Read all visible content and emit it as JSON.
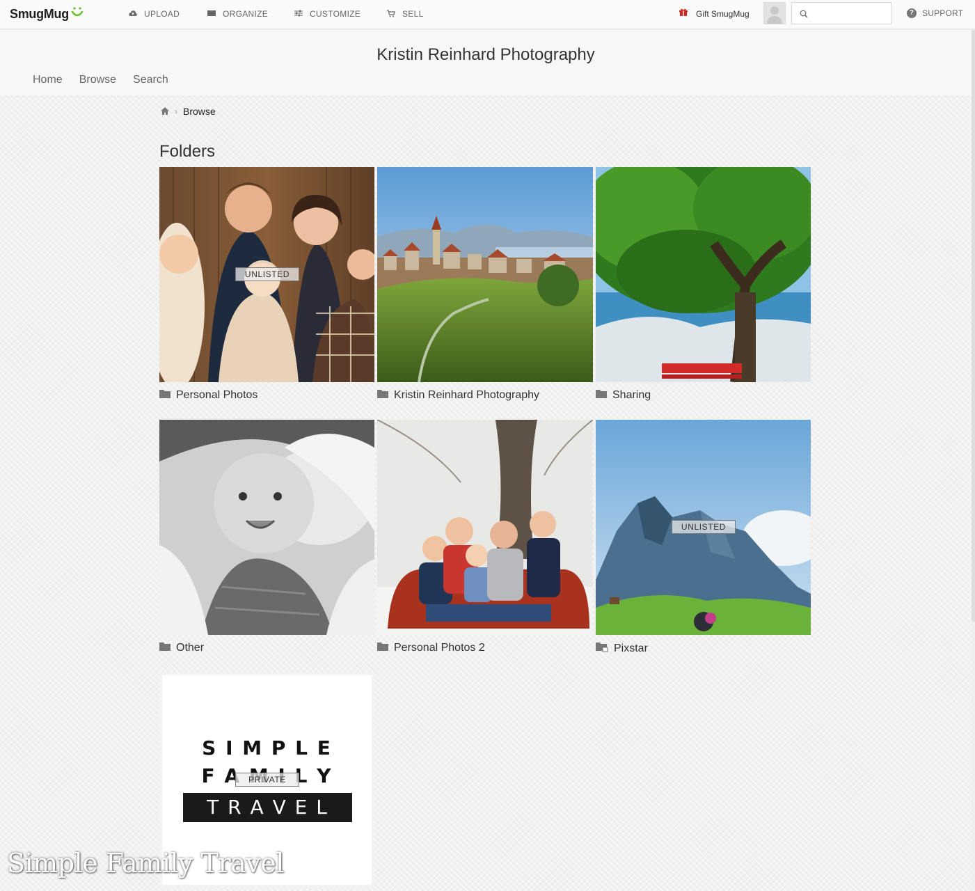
{
  "toolbar": {
    "logo": "SmugMug",
    "nav": [
      "UPLOAD",
      "ORGANIZE",
      "CUSTOMIZE",
      "SELL"
    ],
    "gift_label": "Gift SmugMug",
    "search_placeholder": "",
    "support_label": "SUPPORT"
  },
  "site": {
    "title": "Kristin Reinhard Photography",
    "nav": [
      "Home",
      "Browse",
      "Search"
    ]
  },
  "breadcrumb": {
    "current": "Browse"
  },
  "folders": {
    "heading": "Folders",
    "items": [
      {
        "name": "Personal Photos",
        "badge": "UNLISTED"
      },
      {
        "name": "Kristin Reinhard Photography",
        "badge": ""
      },
      {
        "name": "Sharing",
        "badge": ""
      },
      {
        "name": "Other",
        "badge": ""
      },
      {
        "name": "Personal Photos 2",
        "badge": ""
      },
      {
        "name": "Pixstar",
        "badge": "UNLISTED"
      },
      {
        "name": "",
        "badge": "PRIVATE"
      }
    ]
  },
  "logo_tile": {
    "line1": "S I M P L E",
    "line2": "F A M I L Y",
    "line3": "T R A V E L"
  },
  "watermark": "Simple Family Travel",
  "colors": {
    "brand_green": "#6cbf2d",
    "gift_red": "#d0261f",
    "background": "#efefef"
  }
}
